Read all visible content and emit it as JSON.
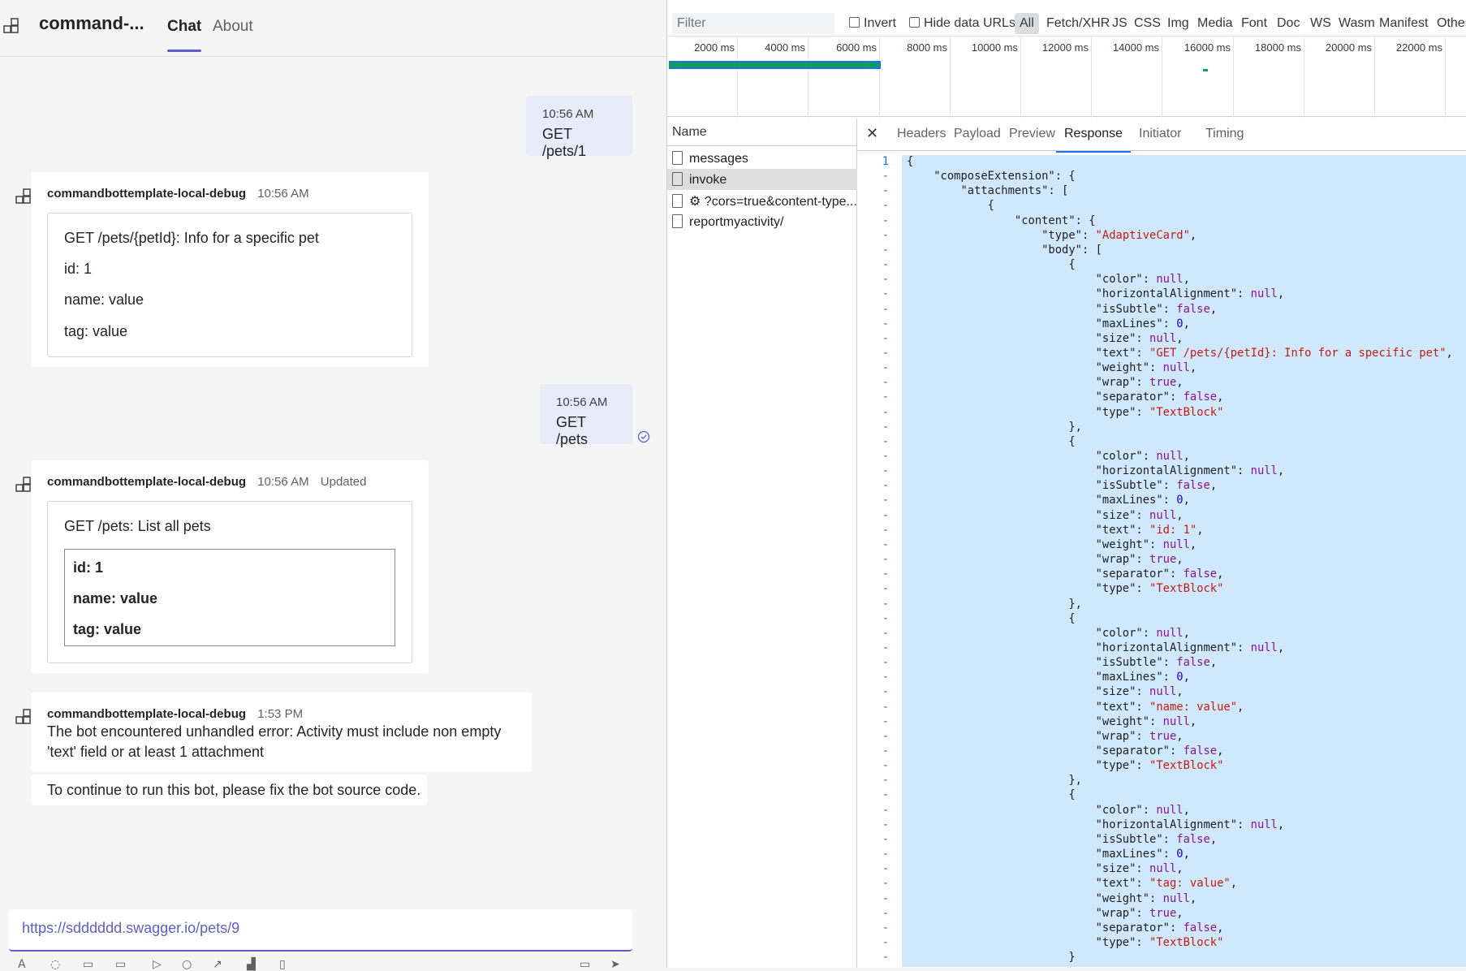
{
  "teams": {
    "app_title": "command-...",
    "tabs": [
      {
        "label": "Chat"
      },
      {
        "label": "About"
      }
    ],
    "messages": {
      "me1": {
        "time": "10:56 AM",
        "text": "GET /pets/1"
      },
      "bot1": {
        "sender": "commandbottemplate-local-debug",
        "time": "10:56 AM",
        "lines": [
          "GET /pets/{petId}: Info for a specific pet",
          "id: 1",
          "name: value",
          "tag: value"
        ]
      },
      "me2": {
        "time": "10:56 AM",
        "text": "GET /pets"
      },
      "bot2": {
        "sender": "commandbottemplate-local-debug",
        "time": "10:56 AM",
        "status": "Updated",
        "title": "GET /pets: List all pets",
        "inner_lines": [
          "id: 1",
          "name: value",
          "tag: value"
        ]
      },
      "bot3": {
        "sender": "commandbottemplate-local-debug",
        "time": "1:53 PM",
        "error_line1": "The bot encountered unhandled error: Activity must include non empty",
        "error_line2": "'text' field or at least 1 attachment",
        "followup": "To continue to run this bot, please fix the bot source code."
      }
    },
    "compose": {
      "value": "https://sdddddd.swagger.io/pets/9"
    }
  },
  "devtools": {
    "filter_placeholder": "Filter",
    "invert_label": "Invert",
    "hide_data_urls_label": "Hide data URLs",
    "type_filters": [
      "All",
      "Fetch/XHR",
      "JS",
      "CSS",
      "Img",
      "Media",
      "Font",
      "Doc",
      "WS",
      "Wasm",
      "Manifest",
      "Other"
    ],
    "timeline_ticks": [
      "2000 ms",
      "4000 ms",
      "6000 ms",
      "8000 ms",
      "10000 ms",
      "12000 ms",
      "14000 ms",
      "16000 ms",
      "18000 ms",
      "20000 ms",
      "22000 ms"
    ],
    "name_header": "Name",
    "requests": [
      "messages",
      "invoke",
      "⚙ ?cors=true&content-type...",
      "reportmyactivity/"
    ],
    "selected_request": "invoke",
    "detail_tabs": [
      "Headers",
      "Payload",
      "Preview",
      "Response",
      "Initiator",
      "Timing"
    ],
    "active_tab": "Response",
    "first_line_number": "1",
    "colors": {
      "accent": "#5b5fc7",
      "devtools_blue": "#1a73e8",
      "selection": "#cfe8fc",
      "string": "#c41a16",
      "keyword": "#881391"
    },
    "response_lines": [
      "{",
      "    \"composeExtension\": {",
      "        \"attachments\": [",
      "            {",
      "                \"content\": {",
      "                    \"type\": \"AdaptiveCard\",",
      "                    \"body\": [",
      "                        {",
      "                            \"color\": null,",
      "                            \"horizontalAlignment\": null,",
      "                            \"isSubtle\": false,",
      "                            \"maxLines\": 0,",
      "                            \"size\": null,",
      "                            \"text\": \"GET /pets/{petId}: Info for a specific pet\",",
      "                            \"weight\": null,",
      "                            \"wrap\": true,",
      "                            \"separator\": false,",
      "                            \"type\": \"TextBlock\"",
      "                        },",
      "                        {",
      "                            \"color\": null,",
      "                            \"horizontalAlignment\": null,",
      "                            \"isSubtle\": false,",
      "                            \"maxLines\": 0,",
      "                            \"size\": null,",
      "                            \"text\": \"id: 1\",",
      "                            \"weight\": null,",
      "                            \"wrap\": true,",
      "                            \"separator\": false,",
      "                            \"type\": \"TextBlock\"",
      "                        },",
      "                        {",
      "                            \"color\": null,",
      "                            \"horizontalAlignment\": null,",
      "                            \"isSubtle\": false,",
      "                            \"maxLines\": 0,",
      "                            \"size\": null,",
      "                            \"text\": \"name: value\",",
      "                            \"weight\": null,",
      "                            \"wrap\": true,",
      "                            \"separator\": false,",
      "                            \"type\": \"TextBlock\"",
      "                        },",
      "                        {",
      "                            \"color\": null,",
      "                            \"horizontalAlignment\": null,",
      "                            \"isSubtle\": false,",
      "                            \"maxLines\": 0,",
      "                            \"size\": null,",
      "                            \"text\": \"tag: value\",",
      "                            \"weight\": null,",
      "                            \"wrap\": true,",
      "                            \"separator\": false,",
      "                            \"type\": \"TextBlock\"",
      "                        }"
    ]
  }
}
